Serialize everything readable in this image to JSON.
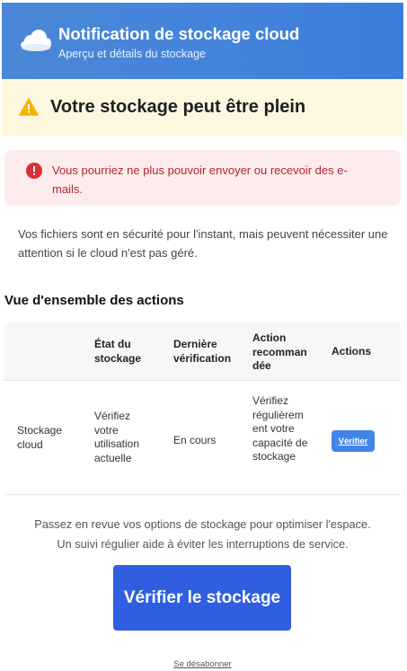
{
  "header": {
    "title": "Notification de stockage cloud",
    "subtitle": "Aperçu et détails du stockage",
    "icon": "cloud-icon"
  },
  "warning": {
    "icon": "warning-triangle-icon",
    "title": "Votre stockage peut être plein"
  },
  "alert": {
    "icon": "error-circle-icon",
    "text": "Vous pourriez ne plus pouvoir envoyer ou recevoir des e-mails."
  },
  "intro": "Vos fichiers sont en sécurité pour l'instant, mais peuvent nécessiter une attention si le cloud n'est pas géré.",
  "actions_section": {
    "title": "Vue d'ensemble des actions",
    "columns": [
      "",
      "État du stockage",
      "Dernière vérification",
      "Action recomman dée",
      "Actions"
    ],
    "rows": [
      {
        "item": "Stockage cloud",
        "state": "Vérifiez votre utilisation actuelle",
        "last_check": "En cours",
        "recommended": "Vérifiez régulièrem ent votre capacité de stockage",
        "action_label": "Vérifier"
      }
    ]
  },
  "footer": {
    "line1": "Passez en revue vos options de stockage pour optimiser l'espace.",
    "line2": "Un suivi régulier aide à éviter les interruptions de service.",
    "cta_label": "Vérifier le stockage",
    "unsubscribe": "Se désabonner"
  },
  "colors": {
    "header": "#4484dc",
    "warning_bg": "#fef7e0",
    "alert_bg": "#fdecee",
    "alert_text": "#b3262e",
    "cta": "#2f5fe0"
  }
}
